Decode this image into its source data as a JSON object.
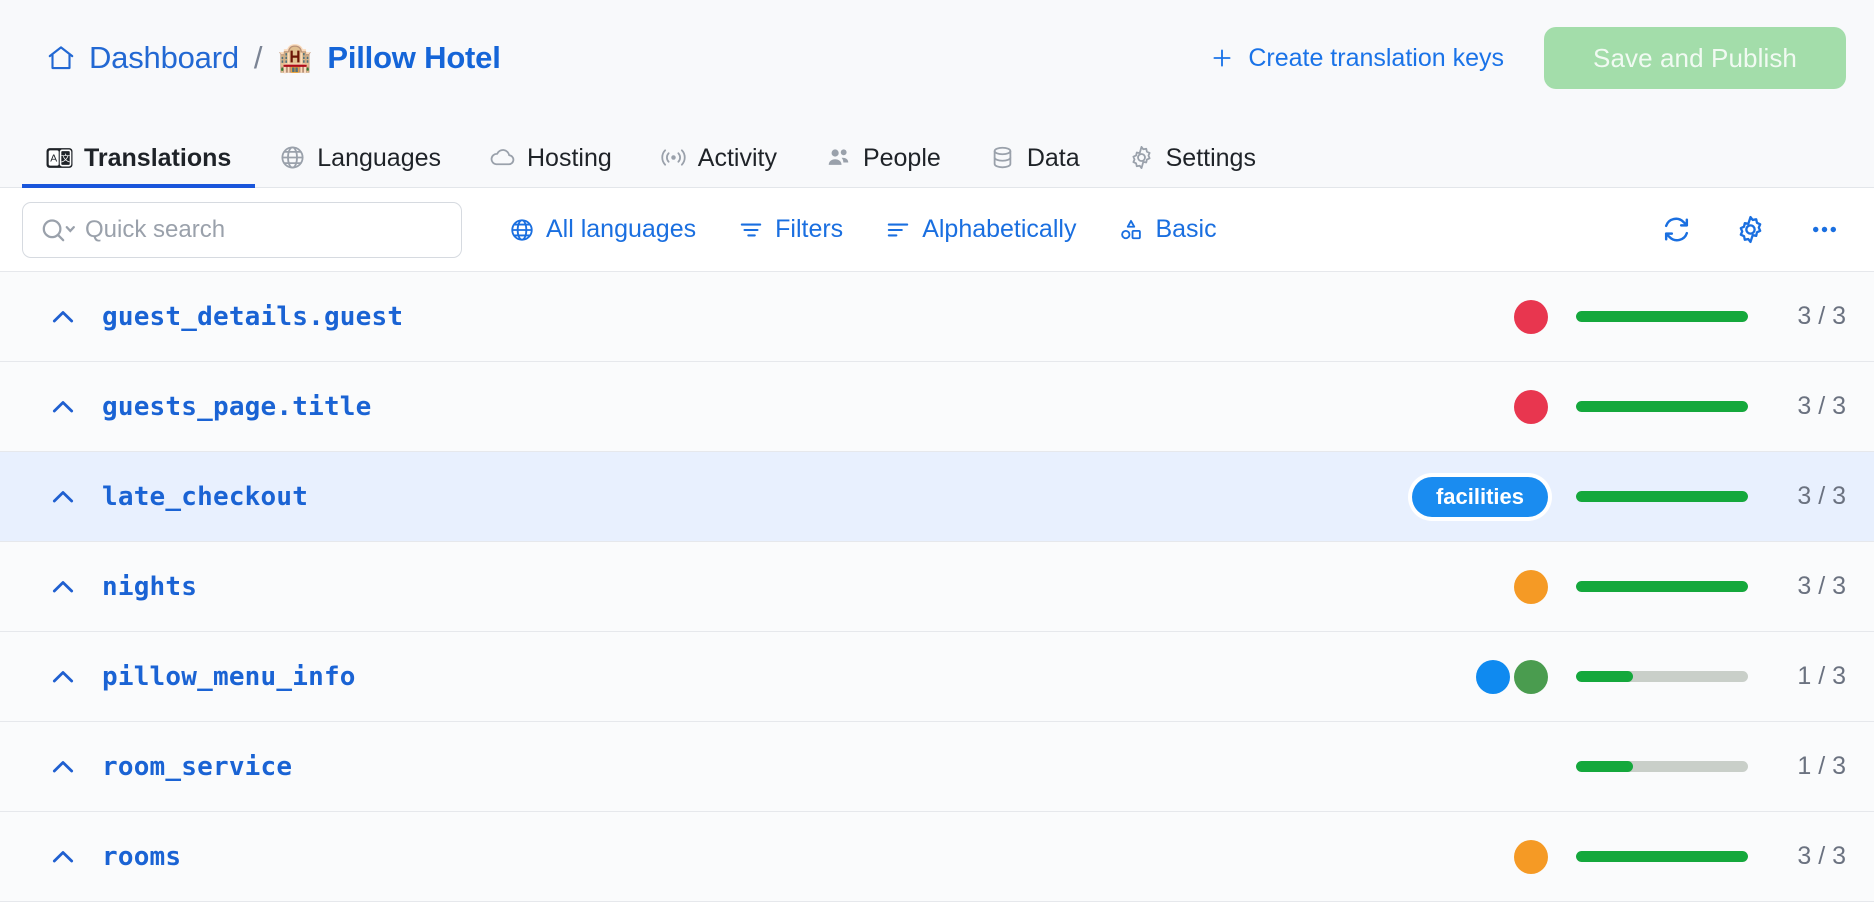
{
  "header": {
    "breadcrumb": {
      "home_icon": "home-icon",
      "parent": "Dashboard",
      "separator": "/",
      "project_emoji": "🏨",
      "project": "Pillow Hotel"
    },
    "create_keys_label": "Create translation keys",
    "publish_label": "Save and Publish"
  },
  "tabs": [
    {
      "label": "Translations",
      "icon": "translate-icon",
      "active": true
    },
    {
      "label": "Languages",
      "icon": "globe-icon",
      "active": false
    },
    {
      "label": "Hosting",
      "icon": "cloud-icon",
      "active": false
    },
    {
      "label": "Activity",
      "icon": "broadcast-icon",
      "active": false
    },
    {
      "label": "People",
      "icon": "people-icon",
      "active": false
    },
    {
      "label": "Data",
      "icon": "database-icon",
      "active": false
    },
    {
      "label": "Settings",
      "icon": "gear-icon",
      "active": false
    }
  ],
  "toolbar": {
    "search_placeholder": "Quick search",
    "search_value": "",
    "links": [
      {
        "label": "All languages",
        "icon": "globe-icon"
      },
      {
        "label": "Filters",
        "icon": "filter-icon"
      },
      {
        "label": "Alphabetically",
        "icon": "sort-icon"
      },
      {
        "label": "Basic",
        "icon": "shapes-icon"
      }
    ],
    "icons": [
      {
        "name": "refresh-icon"
      },
      {
        "name": "gear-icon"
      },
      {
        "name": "more-icon"
      }
    ]
  },
  "colors": {
    "accent": "#1a6fe0",
    "key_blue": "#1a63d4",
    "progress_green": "#14a83c",
    "progress_track": "#c9cfc9",
    "selected_row": "#e8f0fe",
    "tag_red": "#e8364f",
    "tag_orange": "#f59a25",
    "tag_blue": "#1a8cf0",
    "tag_green": "#4a9c4f",
    "publish_disabled": "#a3ddaa"
  },
  "rows": [
    {
      "key": "guest_details.guest",
      "selected": false,
      "tag_dots": [
        {
          "color": "#e8364f"
        }
      ],
      "tag_pill": null,
      "translated": 3,
      "total": 3,
      "count_label": "3 / 3",
      "percent": 100
    },
    {
      "key": "guests_page.title",
      "selected": false,
      "tag_dots": [
        {
          "color": "#e8364f"
        }
      ],
      "tag_pill": null,
      "translated": 3,
      "total": 3,
      "count_label": "3 / 3",
      "percent": 100
    },
    {
      "key": "late_checkout",
      "selected": true,
      "tag_dots": [],
      "tag_pill": "facilities",
      "translated": 3,
      "total": 3,
      "count_label": "3 / 3",
      "percent": 100
    },
    {
      "key": "nights",
      "selected": false,
      "tag_dots": [
        {
          "color": "#f59a25"
        }
      ],
      "tag_pill": null,
      "translated": 3,
      "total": 3,
      "count_label": "3 / 3",
      "percent": 100
    },
    {
      "key": "pillow_menu_info",
      "selected": false,
      "tag_dots": [
        {
          "color": "#0f8af0"
        },
        {
          "color": "#4a9c4f"
        }
      ],
      "tag_pill": null,
      "translated": 1,
      "total": 3,
      "count_label": "1 / 3",
      "percent": 33
    },
    {
      "key": "room_service",
      "selected": false,
      "tag_dots": [],
      "tag_pill": null,
      "translated": 1,
      "total": 3,
      "count_label": "1 / 3",
      "percent": 33
    },
    {
      "key": "rooms",
      "selected": false,
      "tag_dots": [
        {
          "color": "#f59a25"
        }
      ],
      "tag_pill": null,
      "translated": 3,
      "total": 3,
      "count_label": "3 / 3",
      "percent": 100
    }
  ]
}
